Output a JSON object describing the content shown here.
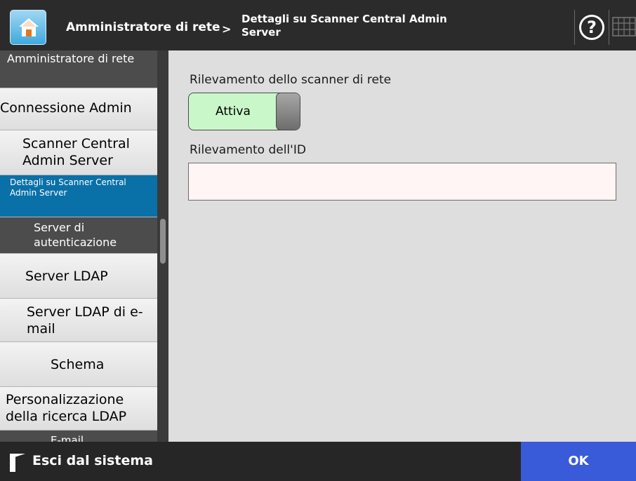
{
  "header": {
    "breadcrumb_root": "Amministratore di rete",
    "separator": ">",
    "breadcrumb_current": "Dettagli su Scanner Central Admin Server",
    "help_symbol": "?",
    "icons": [
      "home-icon",
      "help-icon",
      "keyboard-icon"
    ]
  },
  "sidebar": {
    "items": [
      {
        "label": "Amministratore di rete"
      },
      {
        "label": "Connessione Admin"
      },
      {
        "label": "Scanner Central Admin Server"
      },
      {
        "label": "Dettagli su Scanner Central Admin Server"
      },
      {
        "label": "Server di autenticazione"
      },
      {
        "label": "Server LDAP"
      },
      {
        "label": "Server LDAP di e-mail"
      },
      {
        "label": "Schema"
      },
      {
        "label": "Personalizzazione della ricerca LDAP"
      },
      {
        "label": "E-mail"
      }
    ]
  },
  "main": {
    "scanner_detection_label": "Rilevamento dello scanner di rete",
    "toggle_value": "Attiva",
    "id_detection_label": "Rilevamento dell'ID",
    "id_value": ""
  },
  "footer": {
    "logout_label": "Esci dal sistema",
    "ok_label": "OK"
  },
  "colors": {
    "header_bg": "#2b2b2b",
    "active_nav": "#0a70a8",
    "toggle_on": "#c9f7c9",
    "ok_button": "#3a5bd9"
  }
}
